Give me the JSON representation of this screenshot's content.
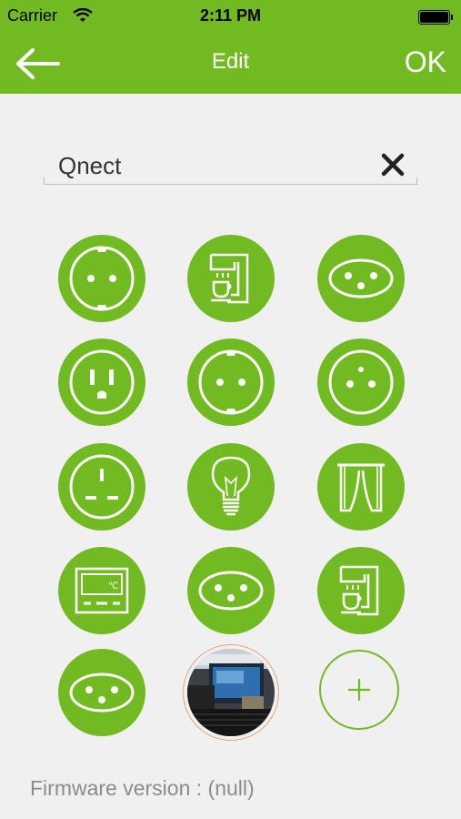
{
  "status_bar": {
    "carrier": "Carrier",
    "time": "2:11 PM"
  },
  "nav": {
    "title": "Edit",
    "ok_label": "OK"
  },
  "name_field": {
    "value": "Qnect"
  },
  "colors": {
    "accent": "#72ba22",
    "background": "#f0f0f0",
    "photo_ring": "#e8a27a"
  },
  "icons": [
    {
      "name": "schuko-socket-icon"
    },
    {
      "name": "coffee-machine-icon"
    },
    {
      "name": "swiss-socket-oval-icon"
    },
    {
      "name": "us-socket-icon"
    },
    {
      "name": "schuko-socket-icon"
    },
    {
      "name": "french-socket-icon"
    },
    {
      "name": "uk-socket-icon"
    },
    {
      "name": "light-bulb-icon"
    },
    {
      "name": "curtains-icon"
    },
    {
      "name": "thermostat-icon",
      "label": "℃"
    },
    {
      "name": "swiss-socket-oval-icon"
    },
    {
      "name": "coffee-machine-icon"
    },
    {
      "name": "swiss-socket-oval-icon"
    }
  ],
  "firmware": {
    "text": "Firmware version : (null)"
  }
}
